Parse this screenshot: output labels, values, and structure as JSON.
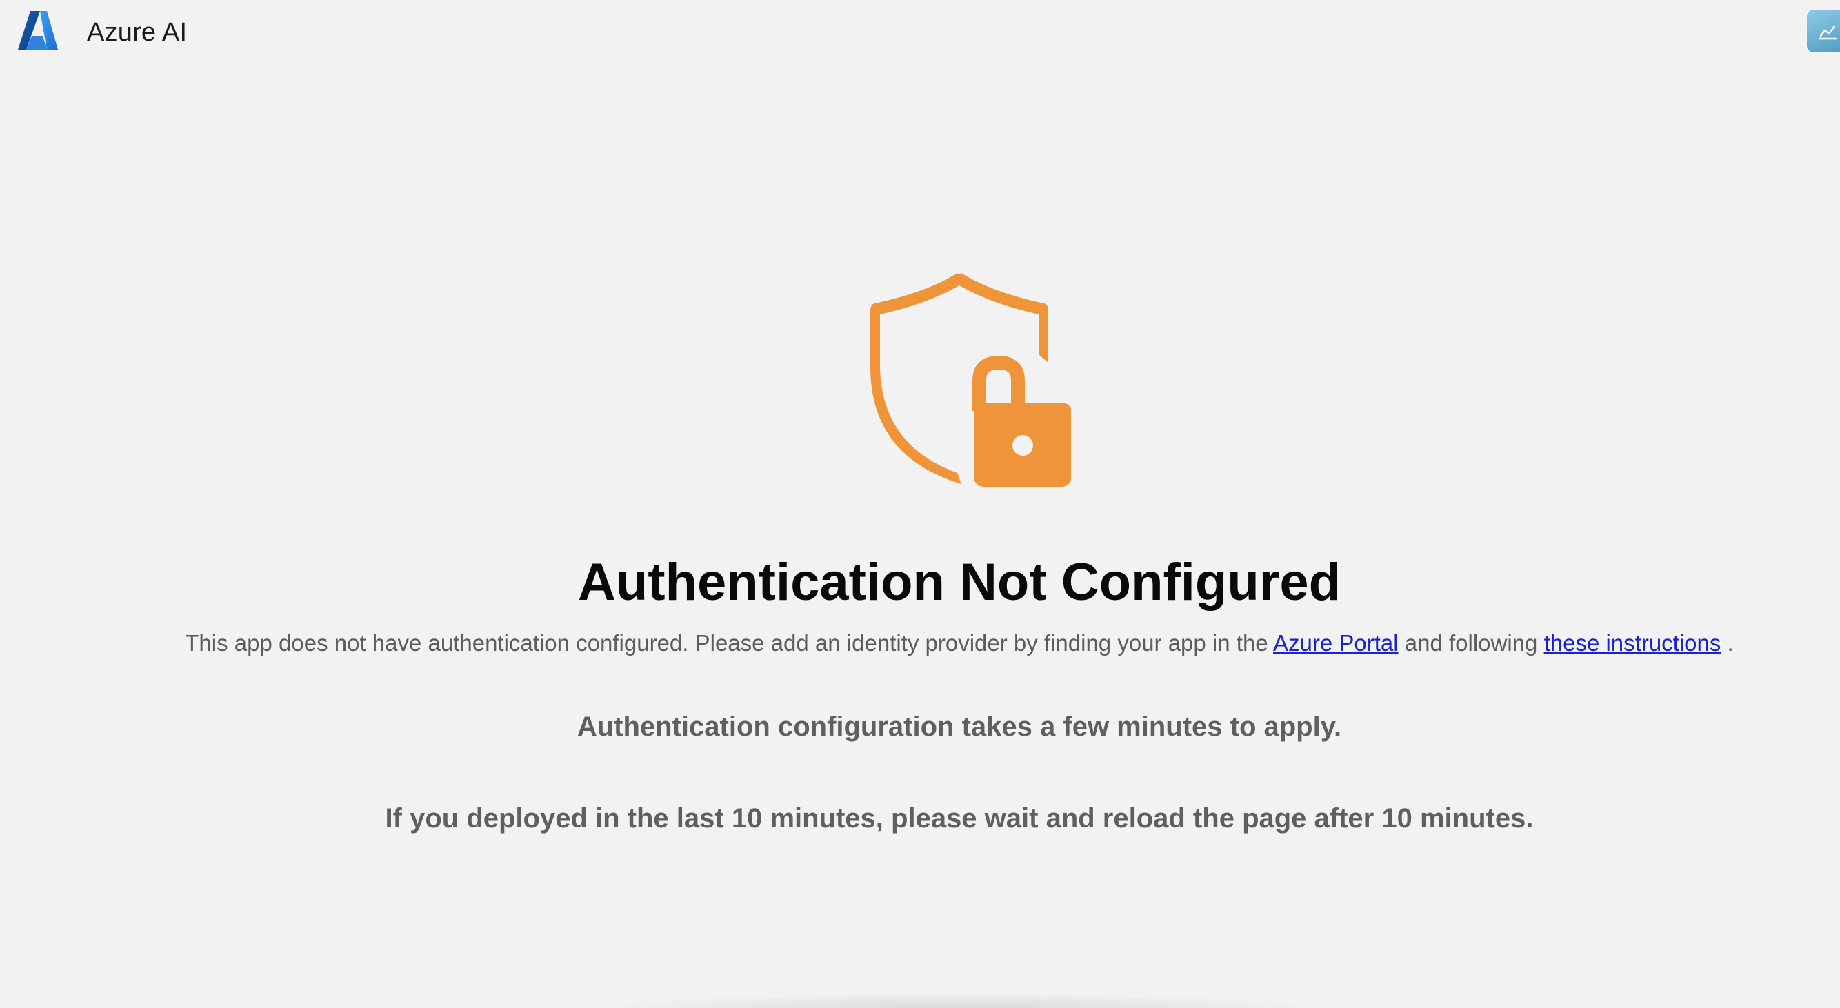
{
  "header": {
    "logo_icon": "azure-logo-icon",
    "title": "Azure AI",
    "right_button_icon": "chat-history-icon"
  },
  "main": {
    "status_icon": "shield-lock-icon",
    "icon_color": "#F0943A",
    "heading": "Authentication Not Configured",
    "description": {
      "prefix": "This app does not have authentication configured. Please add an identity provider by finding your app in the ",
      "portal_link": "Azure Portal",
      "middle": " and following ",
      "instructions_link": "these instructions",
      "suffix": " ."
    },
    "note_1": "Authentication configuration takes a few minutes to apply.",
    "note_2": "If you deployed in the last 10 minutes, please wait and reload the page after 10 minutes."
  },
  "colors": {
    "background": "#F2F2F2",
    "link": "#1A23C9",
    "muted_text": "#5C5C5C"
  }
}
